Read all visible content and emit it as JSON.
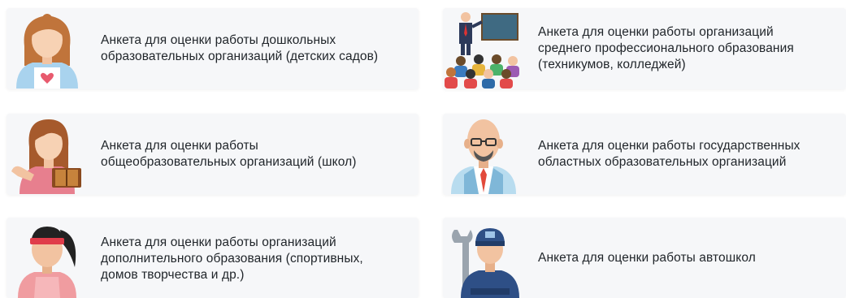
{
  "cards": [
    {
      "label": "Анкета для оценки работы дошкольных образовательных организаций (детских садов)",
      "icon": "female-teacher-kindergarten-icon"
    },
    {
      "label": "Анкета для оценки работы организаций среднего профессионального образования (техникумов, колледжей)",
      "icon": "lecturer-with-students-icon"
    },
    {
      "label": "Анкета для оценки работы общеобразовательных организаций (школ)",
      "icon": "female-teacher-with-book-icon"
    },
    {
      "label": "Анкета для оценки работы государственных областных образовательных организаций",
      "icon": "bald-man-with-glasses-icon"
    },
    {
      "label": "Анкета для оценки работы организаций дополнительного образования (спортивных, домов творчества и др.)",
      "icon": "sports-coach-headband-icon"
    },
    {
      "label": "Анкета для оценки работы автошкол",
      "icon": "mechanic-with-wrench-icon"
    }
  ]
}
